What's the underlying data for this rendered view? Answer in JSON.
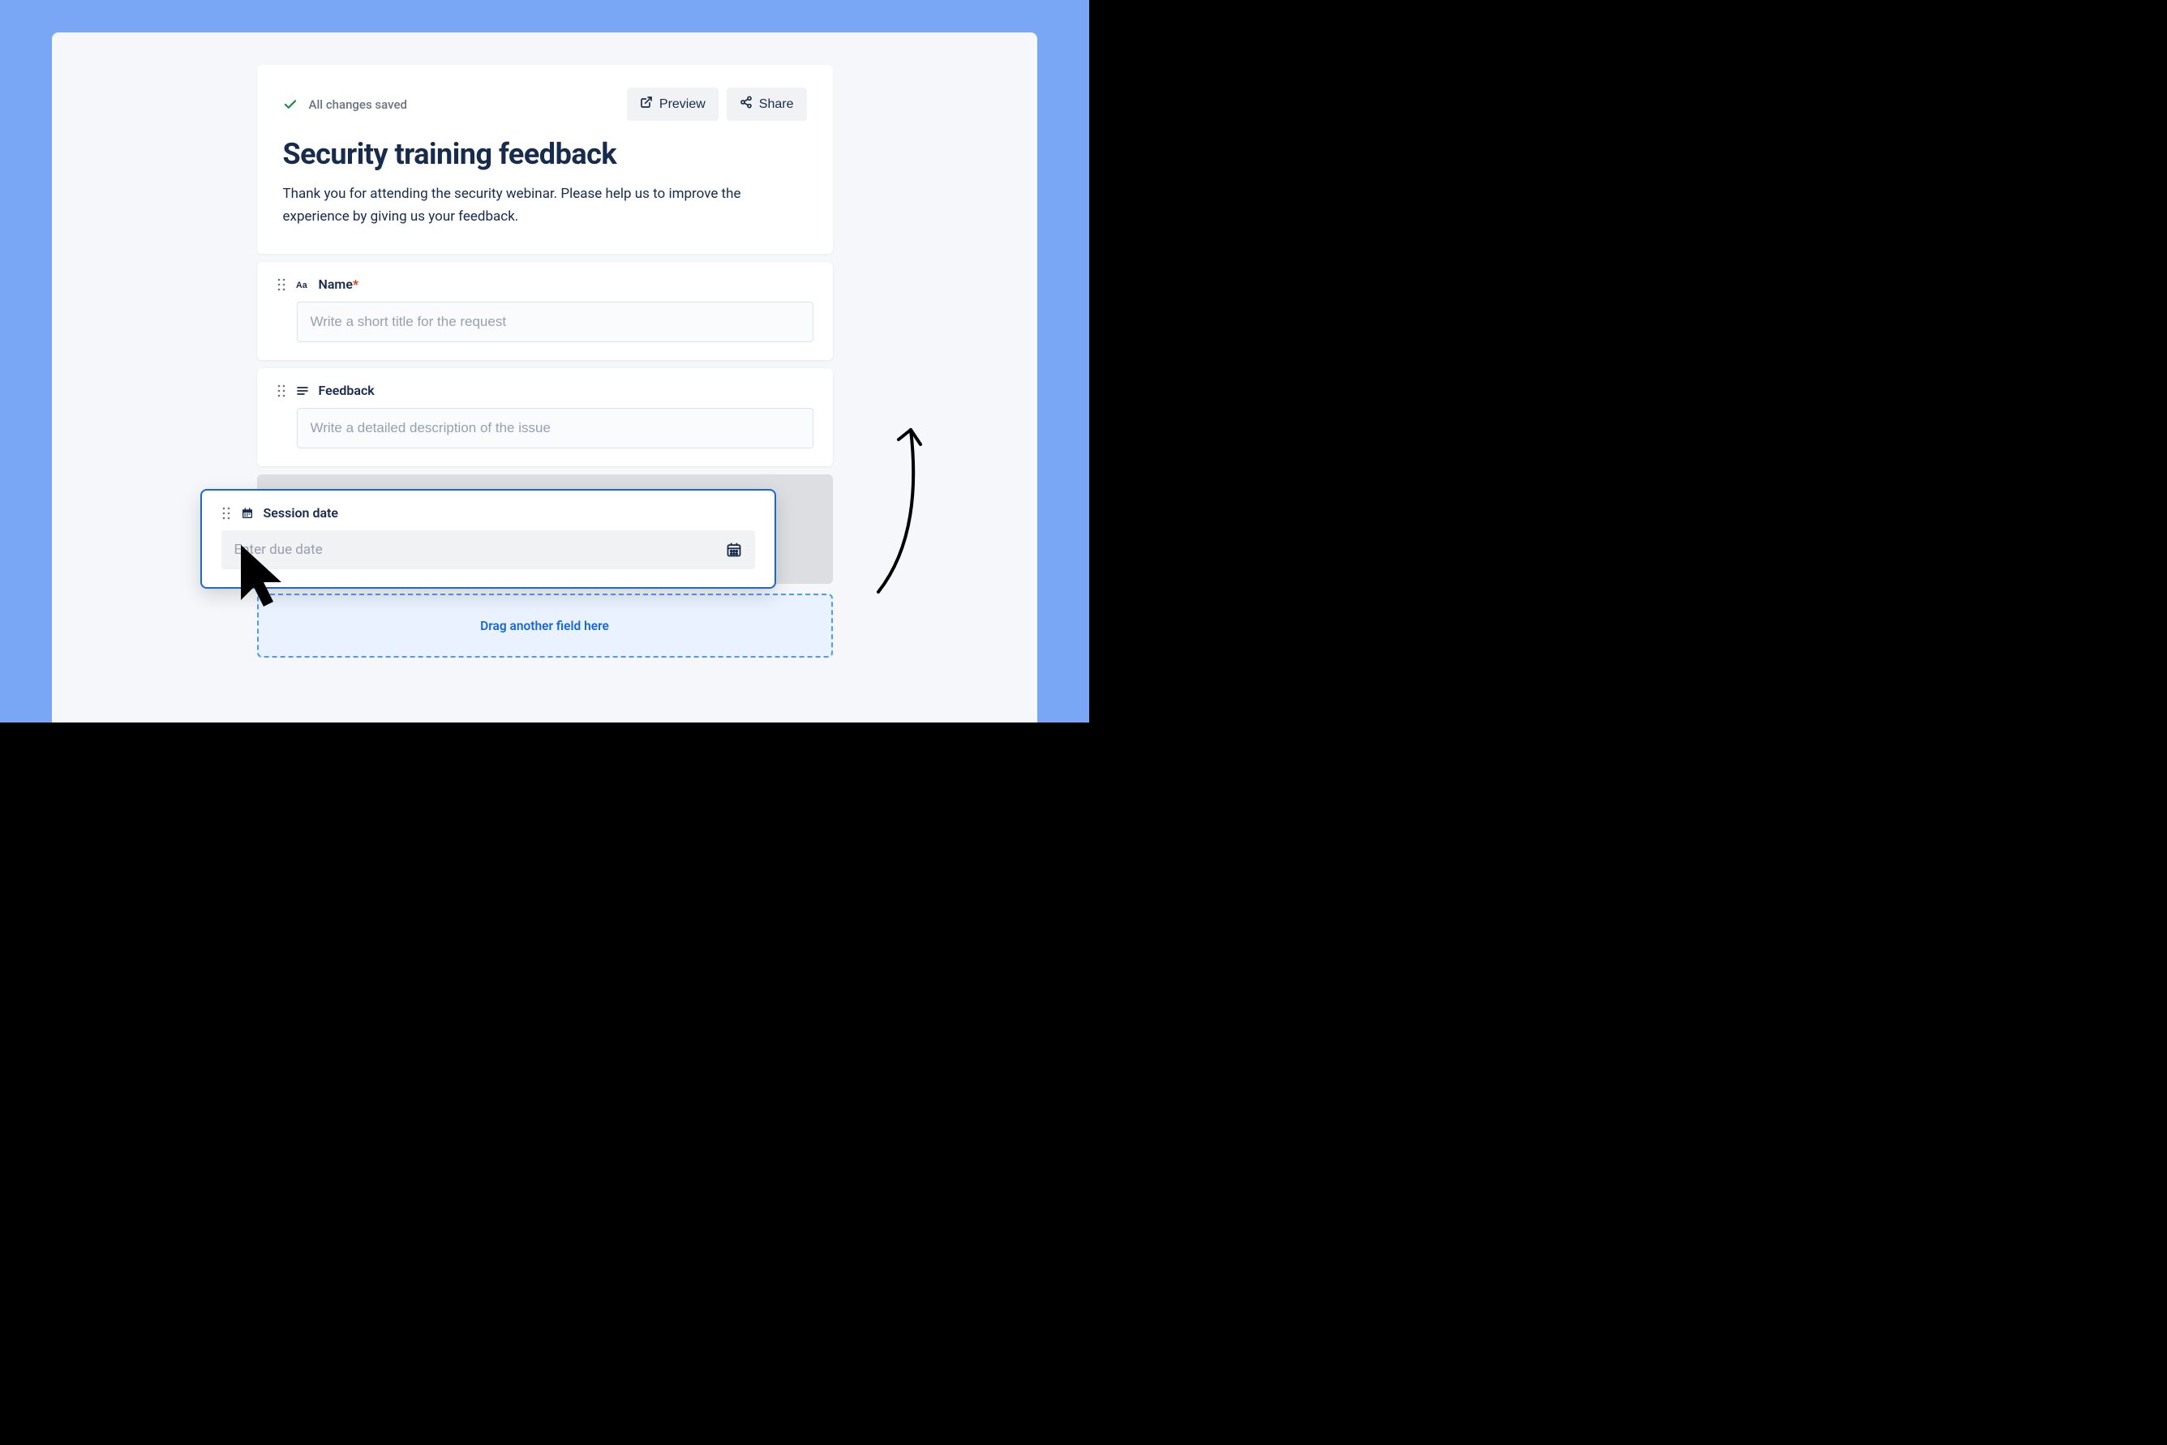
{
  "header": {
    "save_status": "All changes saved",
    "preview_label": "Preview",
    "share_label": "Share"
  },
  "form": {
    "title": "Security training feedback",
    "description": "Thank you for attending the security webinar. Please help us to improve the experience by giving us your feedback."
  },
  "fields": {
    "name": {
      "label": "Name",
      "placeholder": "Write a short title for the request",
      "required": true
    },
    "feedback": {
      "label": "Feedback",
      "placeholder": "Write a detailed description of the issue",
      "required": false
    },
    "session_date": {
      "label": "Session date",
      "placeholder": "Enter due date",
      "required": false
    }
  },
  "drop_zone": {
    "label": "Drag another field here"
  }
}
